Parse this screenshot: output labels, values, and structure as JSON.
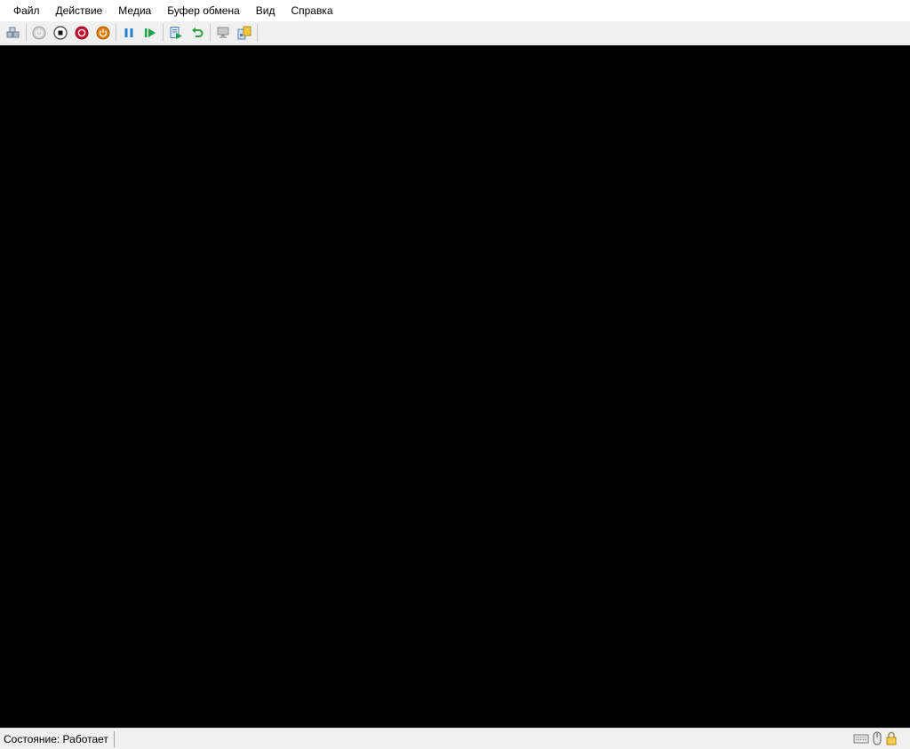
{
  "menu": {
    "items": [
      "Файл",
      "Действие",
      "Медиа",
      "Буфер обмена",
      "Вид",
      "Справка"
    ]
  },
  "toolbar": {
    "buttons": [
      "ctrl-alt-del-icon",
      "start-icon",
      "turn-off-icon",
      "shutdown-icon",
      "save-icon",
      "pause-icon",
      "resume-icon",
      "checkpoint-icon",
      "revert-icon",
      "enhanced-session-icon",
      "share-icon"
    ]
  },
  "status": {
    "label": "Состояние: Работает",
    "icons": [
      "keyboard-icon",
      "mouse-icon",
      "lock-icon"
    ]
  },
  "colors": {
    "screen": "#000000",
    "chrome": "#f0f0f0",
    "stop_red": "#c8102e",
    "save_orange": "#e07b00",
    "pause_blue": "#1f7fd0",
    "resume_green": "#1ea34a"
  }
}
